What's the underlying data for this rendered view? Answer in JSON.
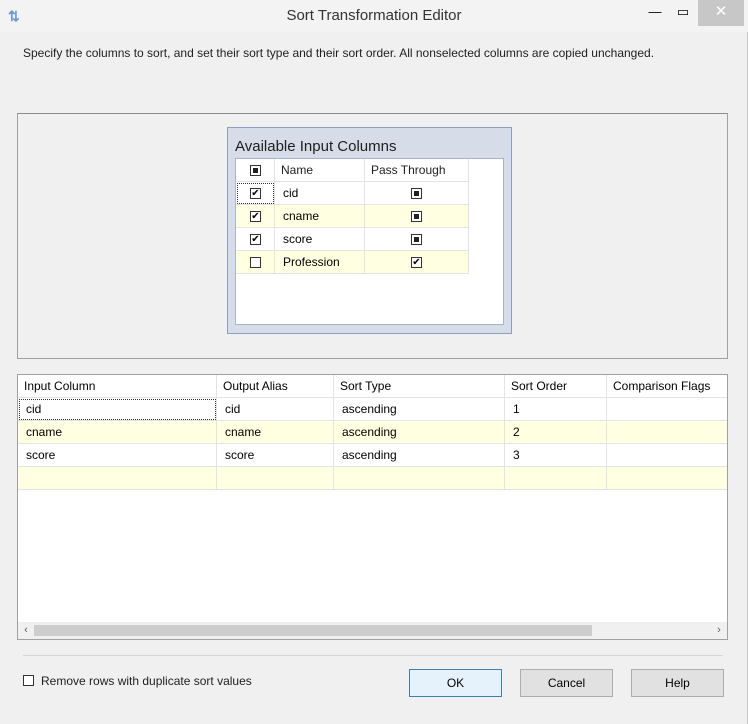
{
  "window": {
    "title": "Sort Transformation Editor"
  },
  "instruction": "Specify the columns to sort, and set their sort type and their sort order. All nonselected columns are copied unchanged.",
  "available": {
    "title": "Available Input Columns",
    "headers": {
      "name": "Name",
      "pass": "Pass Through"
    },
    "rows": [
      {
        "name": "cid",
        "selected": true,
        "pass": "indeterminate"
      },
      {
        "name": "cname",
        "selected": true,
        "pass": "indeterminate"
      },
      {
        "name": "score",
        "selected": true,
        "pass": "indeterminate"
      },
      {
        "name": "Profession",
        "selected": false,
        "pass": "checked"
      }
    ]
  },
  "sort_grid": {
    "headers": [
      "Input Column",
      "Output Alias",
      "Sort Type",
      "Sort Order",
      "Comparison Flags"
    ],
    "rows": [
      [
        "cid",
        "cid",
        "ascending",
        "1",
        ""
      ],
      [
        "cname",
        "cname",
        "ascending",
        "2",
        ""
      ],
      [
        "score",
        "score",
        "ascending",
        "3",
        ""
      ],
      [
        "",
        "",
        "",
        "",
        ""
      ]
    ]
  },
  "options": {
    "remove_duplicates_label": "Remove rows with duplicate sort values",
    "remove_duplicates": false
  },
  "buttons": {
    "ok": "OK",
    "cancel": "Cancel",
    "help": "Help"
  }
}
